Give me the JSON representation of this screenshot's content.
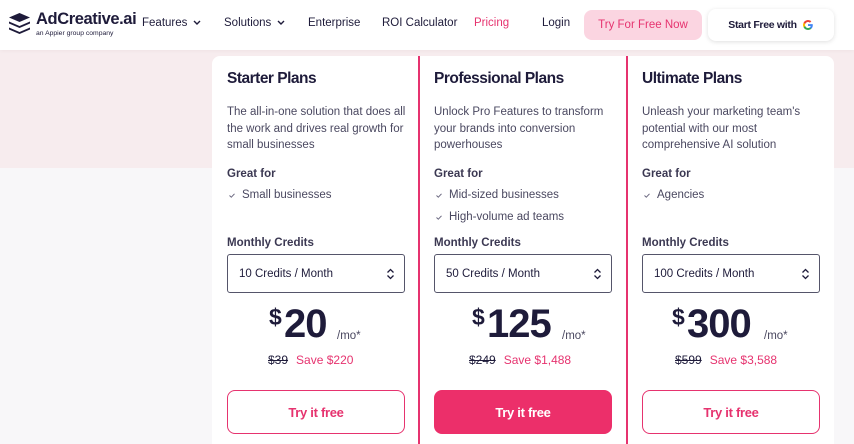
{
  "navbar": {
    "logo": {
      "name": "AdCreative.ai",
      "subtitle": "an Appier group company",
      "icon": "stacked-layers-logo-icon"
    },
    "items": [
      {
        "label": "Features",
        "has_dropdown": true
      },
      {
        "label": "Solutions",
        "has_dropdown": true
      },
      {
        "label": "Enterprise",
        "has_dropdown": false
      },
      {
        "label": "ROI Calculator",
        "has_dropdown": false
      },
      {
        "label": "Pricing",
        "has_dropdown": false,
        "active": true
      },
      {
        "label": "Login",
        "has_dropdown": false
      }
    ],
    "try_button_label": "Try For Free Now",
    "google_button_label": "Start Free with",
    "google_icon": "google-g-icon"
  },
  "plans": [
    {
      "title": "Starter Plans",
      "description": "The all-in-one solution that does all the work and drives real growth for small businesses",
      "great_for_label": "Great for",
      "features": [
        "Small businesses"
      ],
      "credits_label": "Monthly Credits",
      "credits_value": "10 Credits / Month",
      "currency": "$",
      "price": "20",
      "per": "/mo*",
      "old_price": "$39",
      "save": "Save $220",
      "cta": "Try it free",
      "highlighted": false
    },
    {
      "title": "Professional Plans",
      "description": "Unlock Pro Features to transform your brands into conversion powerhouses",
      "great_for_label": "Great for",
      "features": [
        "Mid-sized businesses",
        "High-volume ad teams"
      ],
      "credits_label": "Monthly Credits",
      "credits_value": "50 Credits / Month",
      "currency": "$",
      "price": "125",
      "per": "/mo*",
      "old_price": "$249",
      "save": "Save $1,488",
      "cta": "Try it free",
      "highlighted": true
    },
    {
      "title": "Ultimate Plans",
      "description": "Unleash your marketing team's potential with our most comprehensive AI solution",
      "great_for_label": "Great for",
      "features": [
        "Agencies"
      ],
      "credits_label": "Monthly Credits",
      "credits_value": "100 Credits / Month",
      "currency": "$",
      "price": "300",
      "per": "/mo*",
      "old_price": "$599",
      "save": "Save $3,588",
      "cta": "Try it free",
      "highlighted": false
    }
  ],
  "colors": {
    "accent": "#e6336f",
    "accent_light": "#fbd5e1",
    "text_dark": "#1e1b3a",
    "hero_bg": "#f7ecee"
  }
}
